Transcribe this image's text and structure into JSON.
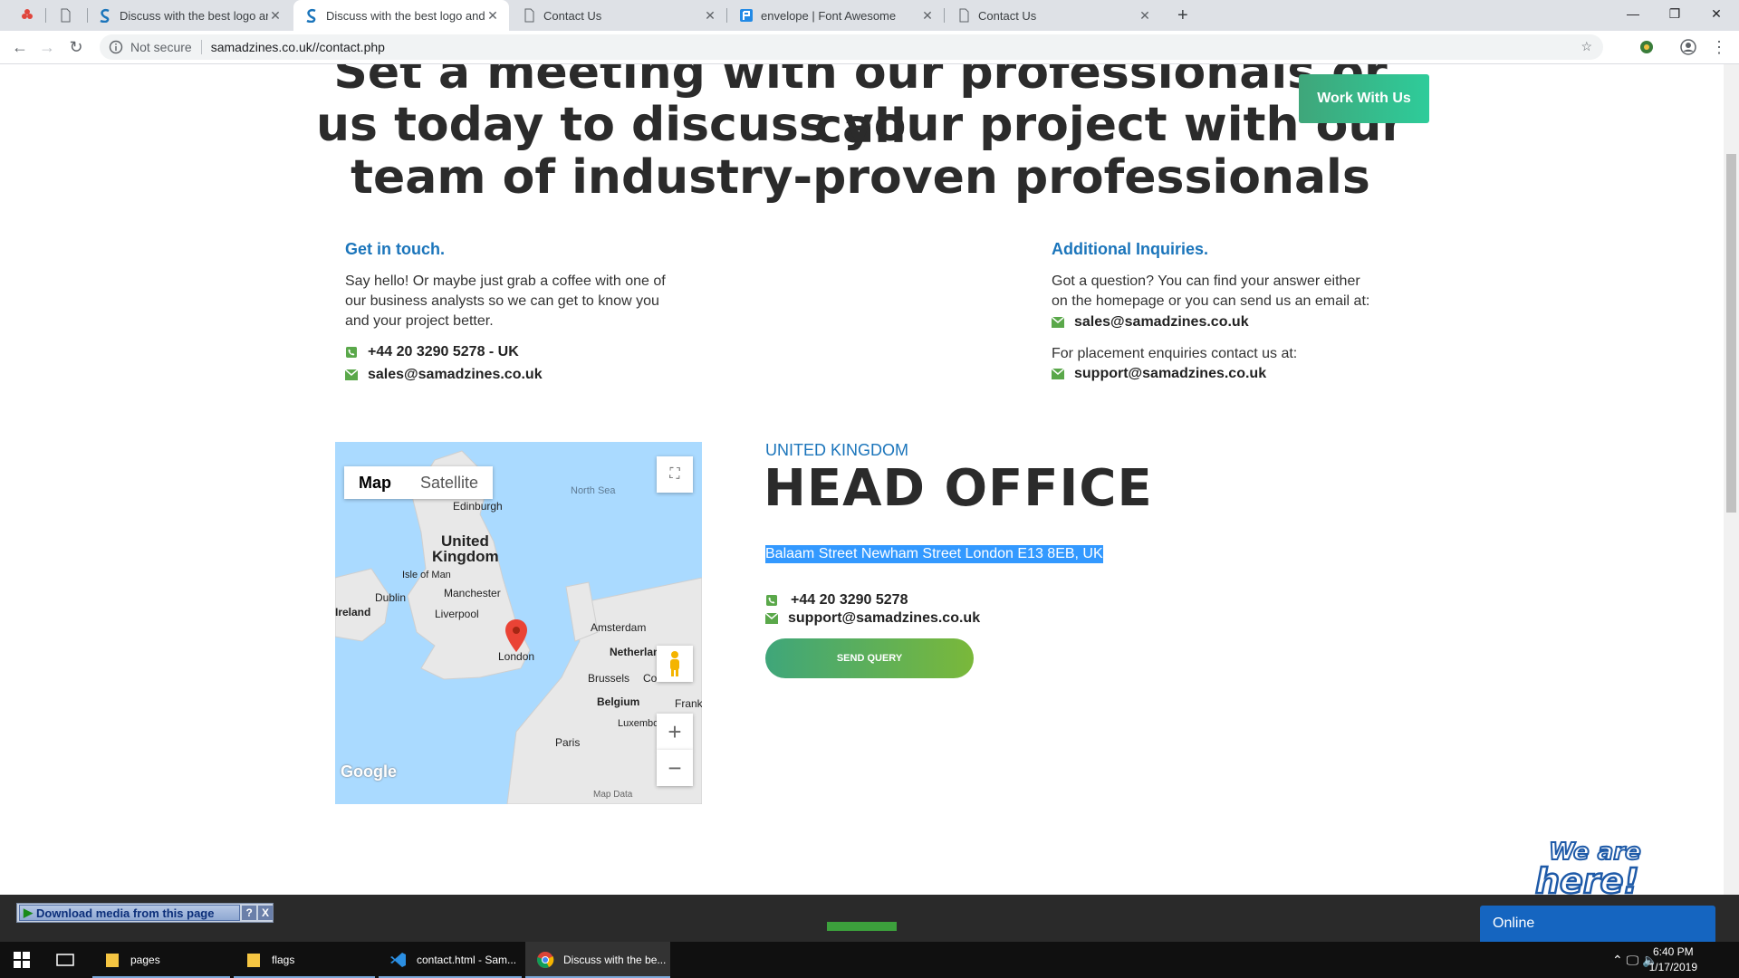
{
  "browser": {
    "tabs": [
      {
        "title": "",
        "icon": "app-icon"
      },
      {
        "title": "Discuss with the best logo and w",
        "icon": "samadzines-icon"
      },
      {
        "title": "Discuss with the best logo and w",
        "icon": "samadzines-icon",
        "active": true
      },
      {
        "title": "Contact Us",
        "icon": "page-icon"
      },
      {
        "title": "envelope | Font Awesome",
        "icon": "font-awesome-icon"
      },
      {
        "title": "Contact Us",
        "icon": "page-icon"
      }
    ],
    "not_secure": "Not secure",
    "url": "samadzines.co.uk//contact.php"
  },
  "hero": {
    "line1": "Set a meeting with our professionals or call",
    "line2": "us today to discuss your project with our",
    "line3": "team of industry-proven professionals",
    "work_button": "Work With Us"
  },
  "get_in_touch": {
    "heading": "Get in touch.",
    "line1": "Say hello! Or maybe just grab a coffee with one of",
    "line2": "our business analysts so we can get to know you",
    "line3": "and your project better.",
    "phone": "+44 20 3290 5278 - UK",
    "email": "sales@samadzines.co.uk"
  },
  "additional": {
    "heading": "Additional Inquiries.",
    "line1": "Got a question? You can find your answer either",
    "line2": "on the homepage or you can send us an email at:",
    "email1": "sales@samadzines.co.uk",
    "placement": "For placement enquiries contact us at:",
    "email2": "support@samadzines.co.uk"
  },
  "map": {
    "type_map": "Map",
    "type_satellite": "Satellite",
    "labels": {
      "north_sea": "North Sea",
      "edinburgh": "Edinburgh",
      "united": "United",
      "kingdom": "Kingdom",
      "isle_of_man": "Isle of Man",
      "dublin": "Dublin",
      "ireland": "Ireland",
      "manchester": "Manchester",
      "liverpool": "Liverpool",
      "london": "London",
      "amsterdam": "Amsterdam",
      "netherlands": "Netherlan",
      "brussels": "Brussels",
      "co": "Co",
      "belgium": "Belgium",
      "frank": "Frank",
      "luxembourg": "Luxembo",
      "paris": "Paris"
    },
    "google": "Google",
    "map_data": "Map Data"
  },
  "head_office": {
    "country": "UNITED KINGDOM",
    "title": "HEAD OFFICE",
    "address": "Balaam Street Newham Street London E13 8EB, UK",
    "phone": "+44 20 3290 5278",
    "email": "support@samadzines.co.uk",
    "send_button": "SEND QUERY"
  },
  "widgets": {
    "download": "Download media from this page",
    "help": "?",
    "close": "X",
    "online": "Online",
    "we_are": "We are",
    "here": "here!"
  },
  "taskbar": {
    "items": [
      {
        "label": "pages",
        "icon": "folder-icon"
      },
      {
        "label": "flags",
        "icon": "folder-icon"
      },
      {
        "label": "contact.html - Sam...",
        "icon": "vscode-icon"
      },
      {
        "label": "Discuss with the be...",
        "icon": "chrome-icon"
      }
    ],
    "time": "6:40 PM",
    "date": "1/17/2019"
  },
  "colors": {
    "accent_blue": "#1b75bb",
    "green": "#5aa84a",
    "heading": "#2b2b2b"
  }
}
